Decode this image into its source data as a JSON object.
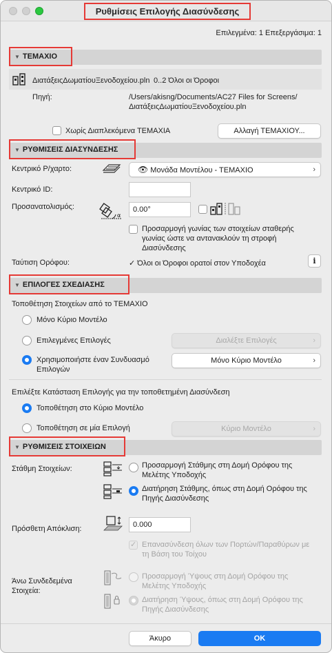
{
  "window": {
    "title": "Ρυθμίσεις Επιλογής Διασύνδεσης",
    "selection_info": "Επιλεγμένα: 1 Επεξεργάσιμα: 1"
  },
  "colors": {
    "accent": "#1a7bf2",
    "highlight": "#e53935"
  },
  "item_section": {
    "header": "ΤΕΜΑΧΙΟ",
    "file_name": "ΔιατάξειςΔωματίουΞενοδοχείου.pln",
    "floors": "0..2 Όλοι οι Όροφοι",
    "source_label": "Πηγή:",
    "source_path_line1": "/Users/akisng/Documents/AC27 Files for Screens/",
    "source_path_line2": "ΔιατάξειςΔωματίουΞενοδοχείου.pln",
    "no_nested_label": "Χωρίς Διαπλεκόμενα ΤΕΜΑΧΙΑ",
    "change_button": "Αλλαγή ΤΕΜΑΧΙΟΥ..."
  },
  "link_settings": {
    "header": "ΡΥΘΜΙΣΕΙΣ ΔΙΑΣΥΝΔΕΣΗΣ",
    "master_label": "Κεντρικό Ρ/χαρτο:",
    "master_value": "Μονάδα Μοντέλου - ΤΕΜΑΧΙΟ",
    "master_id_label": "Κεντρικό ID:",
    "master_id_value": "",
    "orientation_label": "Προσανατολισμός:",
    "orientation_value": "0.00°",
    "adjust_angle_label_1": "Προσαρμογή γωνίας των στοιχείων σταθερής",
    "adjust_angle_label_2": "γωνίας ώστε να αντανακλούν τη στροφή",
    "adjust_angle_label_3": "Διασύνδεσης",
    "floor_match_label": "Ταύτιση Ορόφου:",
    "floor_match_value": "Όλοι οι Όροφοι ορατοί στον Υποδοχέα"
  },
  "design_options": {
    "header": "ΕΠΙΛΟΓΕΣ ΣΧΕΔΙΑΣΗΣ",
    "placement_label": "Τοποθέτηση Στοιχείων από το ΤΕΜΑΧΙΟ",
    "opt_main_only": "Μόνο Κύριο Μοντέλο",
    "opt_selected": "Επιλεγμένες Επιλογές",
    "select_options_button": "Διαλέξτε Επιλογές",
    "opt_combination_1": "Χρησιμοποιήστε έναν Συνδυασμό",
    "opt_combination_2": "Επιλογών",
    "combination_value": "Μόνο Κύριο Μοντέλο",
    "state_label": "Επιλέξτε Κατάσταση Επιλογής για την τοποθετημένη Διασύνδεση",
    "place_main": "Τοποθέτηση στο Κύριο Μοντέλο",
    "place_option": "Τοποθέτηση σε μία Επιλογή",
    "option_value": "Κύριο Μοντέλο"
  },
  "element_settings": {
    "header": "ΡΥΘΜΙΣΕΙΣ ΣΤΟΙΧΕΙΩΝ",
    "elevation_label": "Στάθμη Στοιχείων:",
    "elev_adjust_1": "Προσαρμογή Στάθμης στη Δομή Ορόφου της",
    "elev_adjust_2": "Μελέτης Υποδοχής",
    "elev_keep_1": "Διατήρηση Στάθμης, όπως στη Δομή Ορόφου της",
    "elev_keep_2": "Πηγής Διασύνδεσης",
    "offset_label": "Πρόσθετη Απόκλιση:",
    "offset_value": "0.000",
    "relink_1": "Επανασύνδεση όλων των Πορτών/Παραθύρων με",
    "relink_2": "τη Βάση του Τοίχου",
    "top_linked_1": "Άνω Συνδεδεμένα",
    "top_linked_2": "Στοιχεία:",
    "height_adjust_1": "Προσαρμογή Ύψους στη Δομή Ορόφου της",
    "height_adjust_2": "Μελέτης Υποδοχής",
    "height_keep_1": "Διατήρηση Ύψους, όπως στη Δομή Ορόφου της",
    "height_keep_2": "Πηγής Διασύνδεσης"
  },
  "footer": {
    "cancel": "Άκυρο",
    "ok": "OK"
  }
}
